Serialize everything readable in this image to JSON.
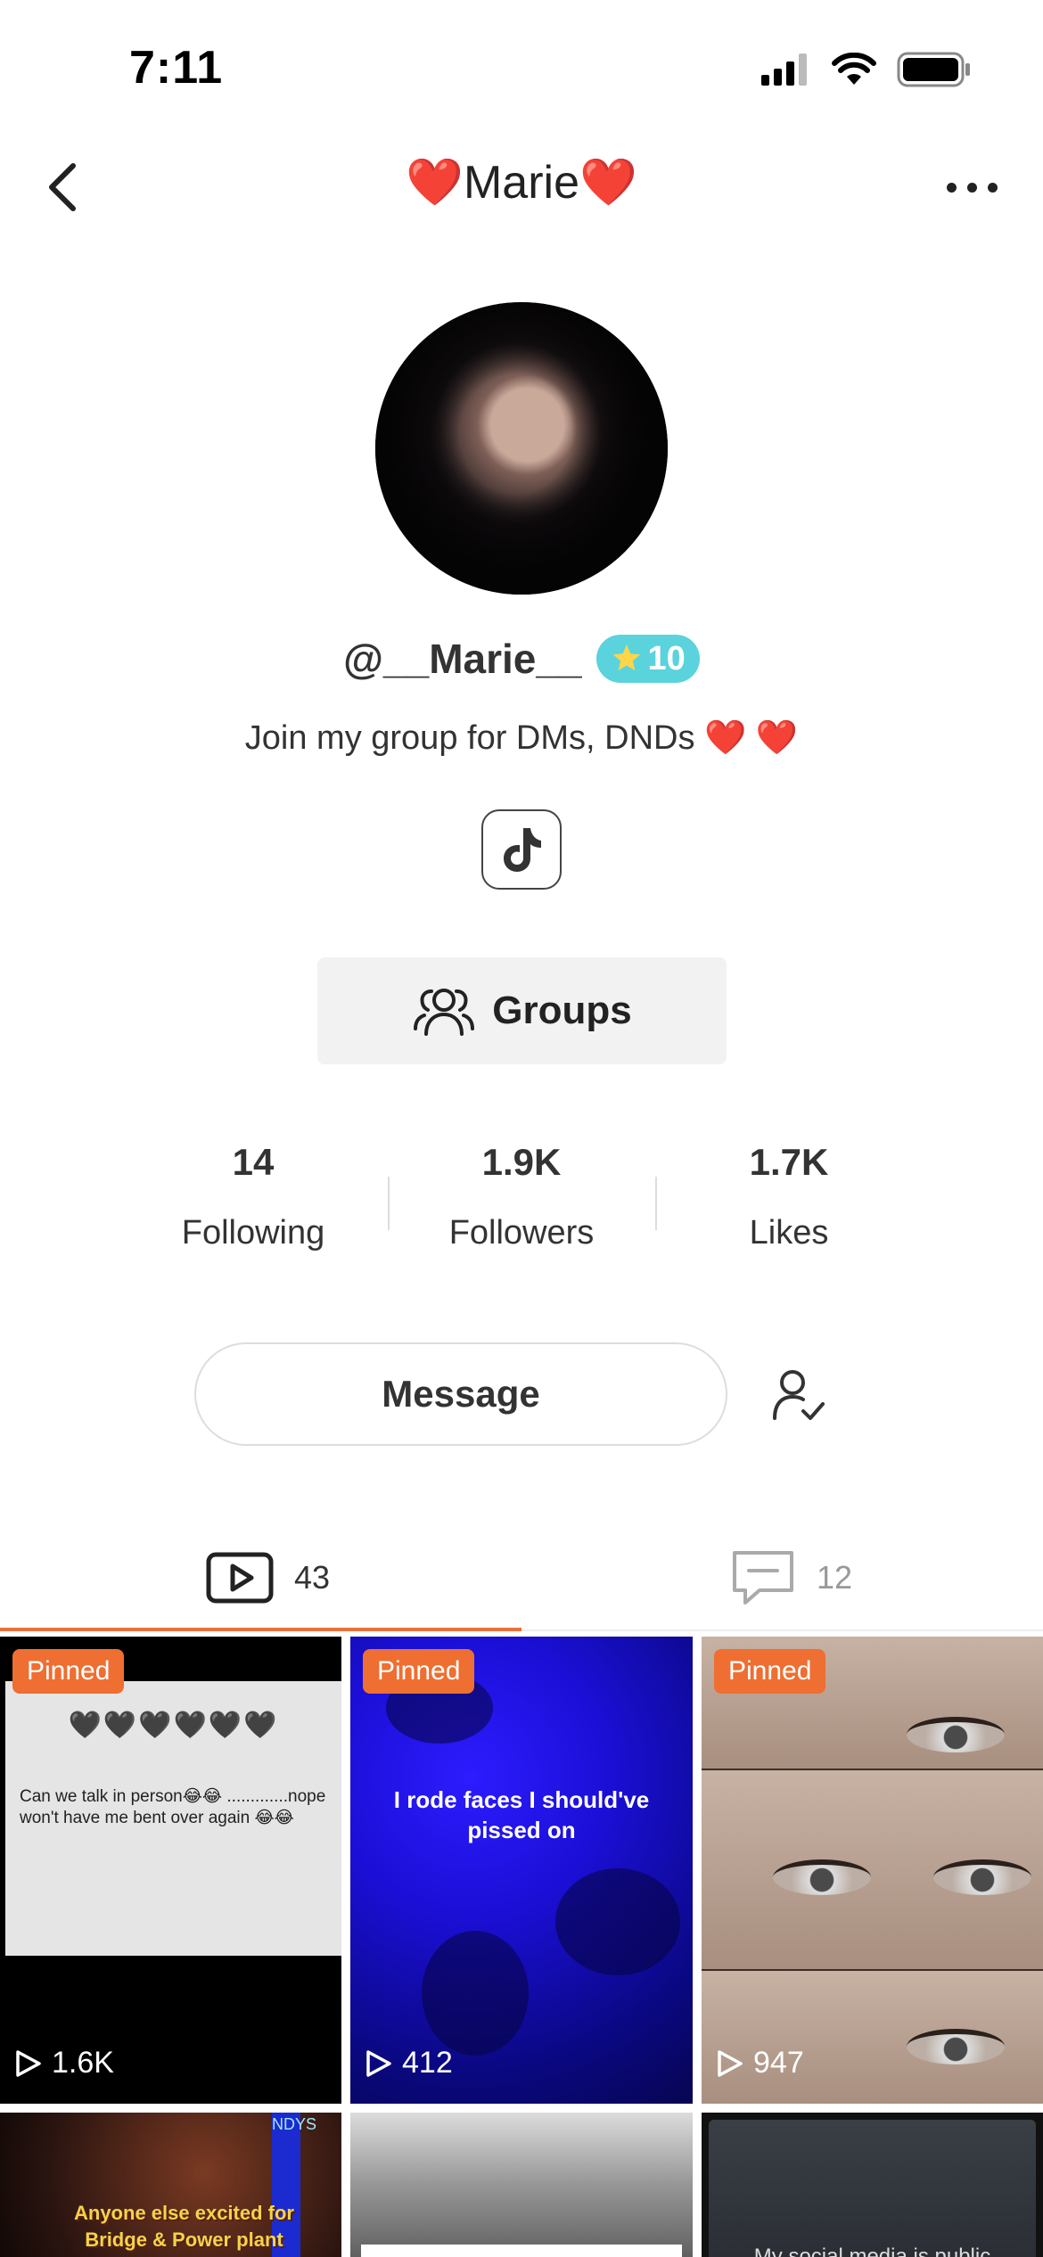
{
  "status_bar": {
    "time": "7:11"
  },
  "nav": {
    "title": "❤️Marie❤️"
  },
  "profile": {
    "handle": "@__Marie__",
    "level": "10",
    "bio": "Join my group for DMs, DNDs ❤️ ❤️",
    "groups_label": "Groups"
  },
  "stats": [
    {
      "value": "14",
      "label": "Following"
    },
    {
      "value": "1.9K",
      "label": "Followers"
    },
    {
      "value": "1.7K",
      "label": "Likes"
    }
  ],
  "actions": {
    "message_label": "Message"
  },
  "tabs": [
    {
      "name": "videos",
      "count": "43",
      "icon": "play-square-icon",
      "active": true
    },
    {
      "name": "posts",
      "count": "12",
      "icon": "comment-icon",
      "active": false
    }
  ],
  "accent_color": "#ee6f31",
  "badge_color": "#5ad3dd",
  "videos": [
    {
      "pinned": "Pinned",
      "views": "1.6K",
      "hearts": "🖤🖤🖤🖤🖤🖤",
      "text": "Can we talk in person😂😂 .............nope won't have me bent over again 😂😂"
    },
    {
      "pinned": "Pinned",
      "views": "412",
      "text": "I rode faces I should've pissed on"
    },
    {
      "pinned": "Pinned",
      "views": "947"
    },
    {
      "text": "Anyone else excited for Bridge & Power plant",
      "sign": "NDYS"
    },
    {
      "text": ""
    },
    {
      "text": "My social media is public"
    }
  ]
}
